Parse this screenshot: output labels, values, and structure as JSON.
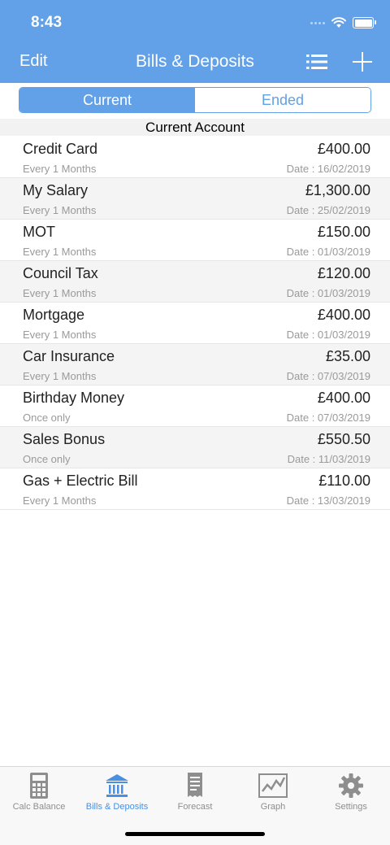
{
  "status": {
    "time": "8:43"
  },
  "nav": {
    "edit_label": "Edit",
    "title": "Bills & Deposits",
    "list_icon": "list-icon",
    "add_icon": "plus-icon"
  },
  "segment": {
    "current": "Current",
    "ended": "Ended",
    "selected": "Current"
  },
  "section": {
    "title": "Current Account"
  },
  "items": [
    {
      "name": "Credit Card",
      "amount": "£400.00",
      "frequency": "Every 1 Months",
      "date": "Date : 16/02/2019"
    },
    {
      "name": "My Salary",
      "amount": "£1,300.00",
      "frequency": "Every 1 Months",
      "date": "Date : 25/02/2019"
    },
    {
      "name": "MOT",
      "amount": "£150.00",
      "frequency": "Every 1 Months",
      "date": "Date : 01/03/2019"
    },
    {
      "name": "Council Tax",
      "amount": "£120.00",
      "frequency": "Every 1 Months",
      "date": "Date : 01/03/2019"
    },
    {
      "name": "Mortgage",
      "amount": "£400.00",
      "frequency": "Every 1 Months",
      "date": "Date : 01/03/2019"
    },
    {
      "name": "Car Insurance",
      "amount": "£35.00",
      "frequency": "Every 1 Months",
      "date": "Date : 07/03/2019"
    },
    {
      "name": "Birthday Money",
      "amount": "£400.00",
      "frequency": "Once only",
      "date": "Date : 07/03/2019"
    },
    {
      "name": "Sales Bonus",
      "amount": "£550.50",
      "frequency": "Once only",
      "date": "Date : 11/03/2019"
    },
    {
      "name": "Gas + Electric Bill",
      "amount": "£110.00",
      "frequency": "Every 1 Months",
      "date": "Date : 13/03/2019"
    }
  ],
  "tabs": [
    {
      "label": "Calc Balance",
      "icon": "calculator-icon"
    },
    {
      "label": "Bills & Deposits",
      "icon": "bank-icon",
      "active": true
    },
    {
      "label": "Forecast",
      "icon": "receipt-icon"
    },
    {
      "label": "Graph",
      "icon": "graph-icon"
    },
    {
      "label": "Settings",
      "icon": "gear-icon"
    }
  ],
  "colors": {
    "accent": "#62a0e7",
    "tab_active": "#4a90e2",
    "tab_inactive": "#8e8e8e",
    "row_alt": "#f4f4f4"
  }
}
